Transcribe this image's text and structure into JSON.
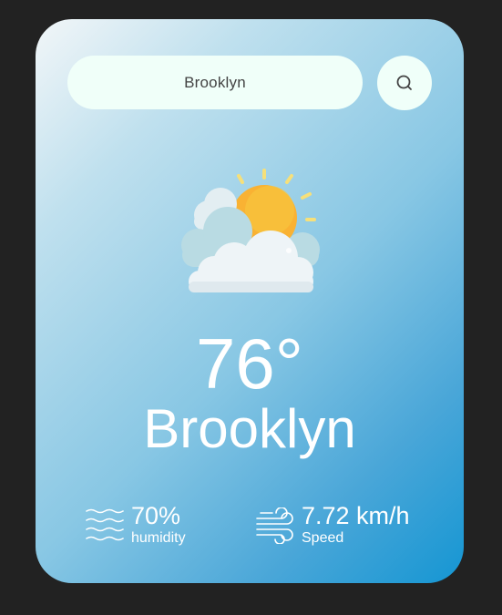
{
  "search": {
    "value": "Brooklyn",
    "button_icon": "search-icon"
  },
  "weather": {
    "icon": "sun-behind-clouds-icon",
    "temperature": "76°",
    "city": "Brooklyn"
  },
  "stats": {
    "humidity": {
      "icon": "waves-icon",
      "value": "70%",
      "label": "humidity"
    },
    "wind": {
      "icon": "wind-icon",
      "value": "7.72 km/h",
      "label": "Speed"
    }
  },
  "colors": {
    "page_background": "#222222",
    "input_background": "#f0fff9",
    "gradient_start": "#f2f6f8",
    "gradient_end": "#1596d3",
    "sun": "#f9b233",
    "text": "#ffffff"
  }
}
